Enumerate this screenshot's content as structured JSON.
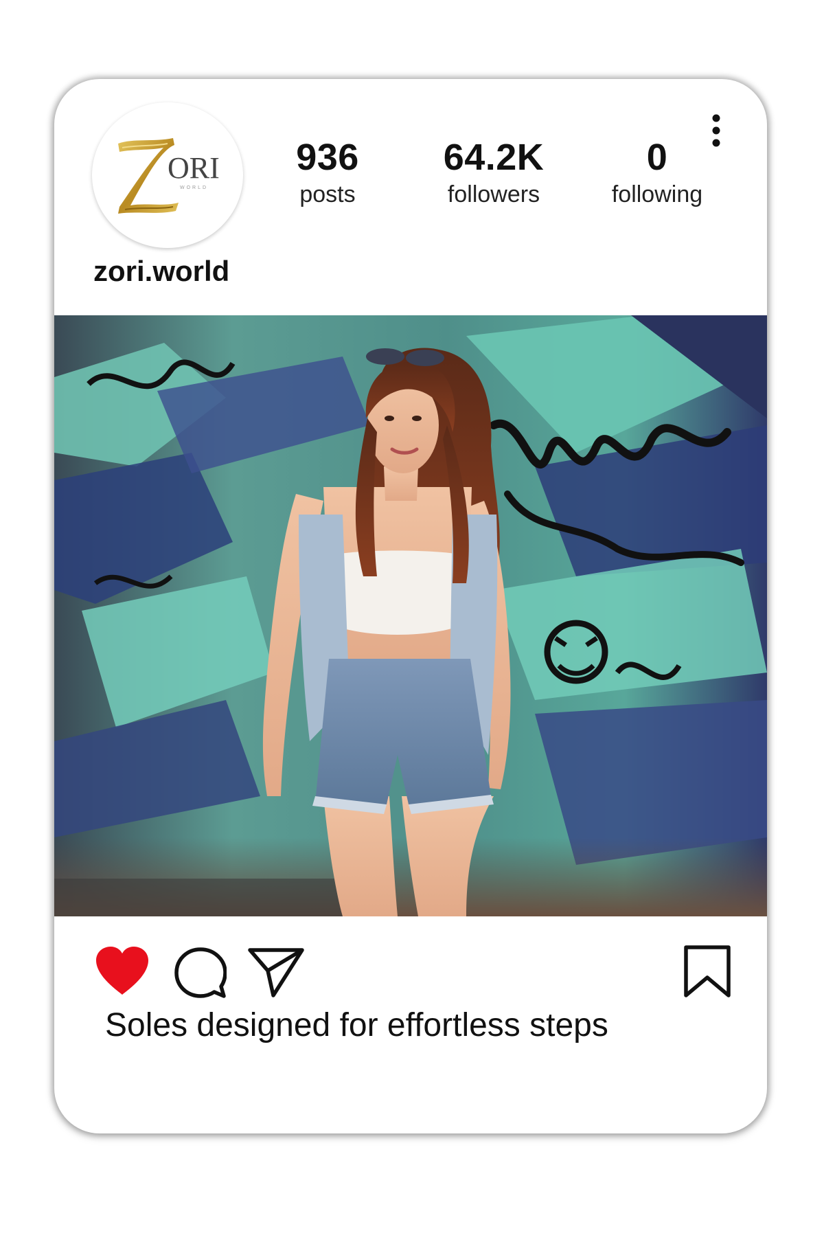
{
  "profile": {
    "username": "zori.world",
    "avatar": {
      "logo_text": "ORI",
      "logo_sub": "WORLD",
      "logo_mark": "Z",
      "logo_color": "#c9a43a"
    }
  },
  "stats": [
    {
      "value": "936",
      "label": "posts"
    },
    {
      "value": "64.2K",
      "label": "followers"
    },
    {
      "value": "0",
      "label": "following"
    }
  ],
  "header": {
    "menu_icon": "more-vertical-icon"
  },
  "post": {
    "image_description_icon": "photo",
    "liked": true,
    "like_color": "#e8101d",
    "caption": "Soles designed for effortless steps"
  },
  "actions": {
    "like_icon": "heart-icon",
    "comment_icon": "comment-icon",
    "share_icon": "send-icon",
    "save_icon": "bookmark-icon"
  }
}
